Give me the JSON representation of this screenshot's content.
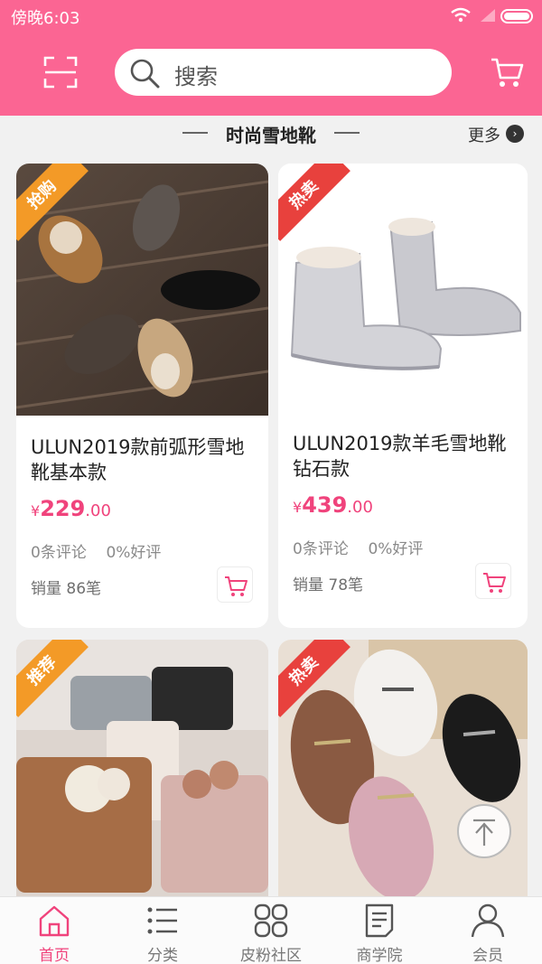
{
  "status_bar": {
    "time": "傍晚6:03"
  },
  "header": {
    "search_placeholder": "搜索"
  },
  "section": {
    "title": "时尚雪地靴",
    "more_label": "更多"
  },
  "products": [
    {
      "tag": "抢购",
      "name": "ULUN2019款前弧形雪地靴基本款",
      "currency": "¥",
      "price_int": "229",
      "price_dec": ".00",
      "reviews": "0条评论",
      "rating": "0%好评",
      "sales": "销量 86笔"
    },
    {
      "tag": "热卖",
      "name": "ULUN2019款羊毛雪地靴钻石款",
      "currency": "¥",
      "price_int": "439",
      "price_dec": ".00",
      "reviews": "0条评论",
      "rating": "0%好评",
      "sales": "销量 78笔"
    },
    {
      "tag": "推荐"
    },
    {
      "tag": "热卖"
    }
  ],
  "tabs": [
    {
      "label": "首页",
      "icon": "home-icon",
      "active": true
    },
    {
      "label": "分类",
      "icon": "list-icon"
    },
    {
      "label": "皮粉社区",
      "icon": "community-icon"
    },
    {
      "label": "商学院",
      "icon": "document-icon"
    },
    {
      "label": "会员",
      "icon": "user-icon"
    }
  ],
  "colors": {
    "brand_pink": "#fb6593",
    "price_pink": "#f0437c",
    "tag_orange": "#f39a27",
    "tag_red": "#e8413d"
  }
}
